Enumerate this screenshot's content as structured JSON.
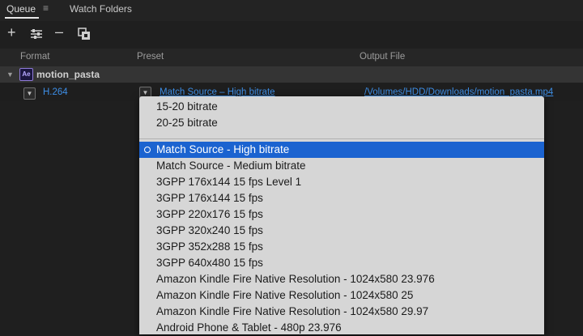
{
  "tabs": {
    "queue": "Queue",
    "menu_icon": "hamburger-icon",
    "watch": "Watch Folders"
  },
  "toolbar": {
    "add_icon": "plus-icon",
    "settings_icon": "settings-sliders-icon",
    "remove_icon": "minus-icon",
    "duplicate_icon": "duplicate-icon"
  },
  "columns": {
    "format": "Format",
    "preset": "Preset",
    "output": "Output File"
  },
  "group": {
    "name": "motion_pasta",
    "badge": "Ae"
  },
  "item": {
    "format": "H.264",
    "preset": "Match Source – High bitrate",
    "output": "/Volumes/HDD/Downloads/motion_pasta.mp4"
  },
  "preset_menu": {
    "selected_index": 2,
    "options": [
      "15-20 bitrate",
      "20-25 bitrate",
      "Match Source - High bitrate",
      "Match Source - Medium bitrate",
      "3GPP 176x144 15 fps Level 1",
      "3GPP 176x144 15 fps",
      "3GPP 220x176 15 fps",
      "3GPP 320x240 15 fps",
      "3GPP 352x288 15 fps",
      "3GPP 640x480 15 fps",
      "Amazon Kindle Fire Native Resolution - 1024x580 23.976",
      "Amazon Kindle Fire Native Resolution - 1024x580 25",
      "Amazon Kindle Fire Native Resolution - 1024x580 29.97",
      "Android Phone & Tablet - 480p 23.976"
    ]
  },
  "colors": {
    "accent": "#3d8ee6",
    "selection": "#1b63d0",
    "menu_bg": "#d6d6d6",
    "panel_bg": "#1f1f1f"
  }
}
